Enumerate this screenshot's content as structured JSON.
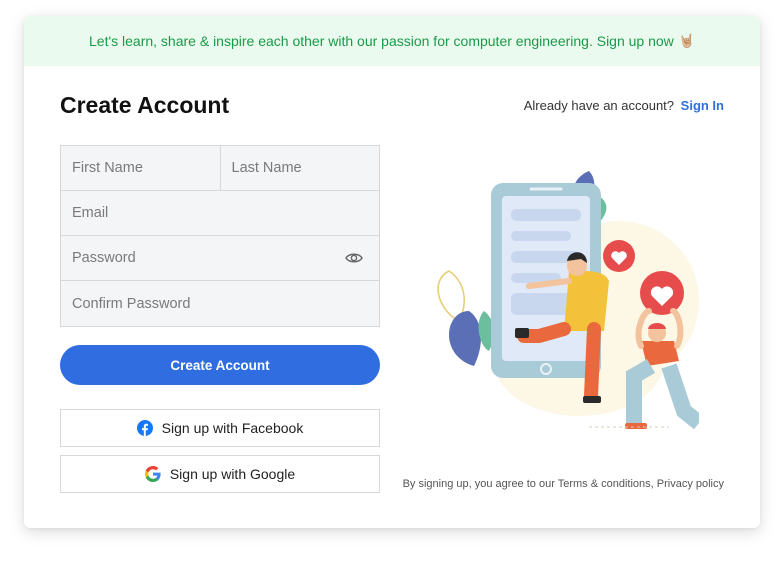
{
  "banner": {
    "text": "Let's learn, share & inspire each other with our passion for computer engineering. Sign up now",
    "emoji": "🤘🏼"
  },
  "header": {
    "title": "Create Account",
    "already_text": "Already have an account?",
    "signin_label": "Sign In"
  },
  "form": {
    "first_name_placeholder": "First Name",
    "last_name_placeholder": "Last Name",
    "email_placeholder": "Email",
    "password_placeholder": "Password",
    "confirm_password_placeholder": "Confirm Password",
    "password_visibility_icon": "eye-icon"
  },
  "buttons": {
    "create_account_label": "Create Account",
    "facebook_label": "Sign up with Facebook",
    "google_label": "Sign up with Google"
  },
  "footer": {
    "terms_text": "By signing up, you agree to our Terms & conditions, Privacy policy"
  },
  "colors": {
    "primary": "#2f6de1",
    "banner_bg": "#ebfaef",
    "banner_text": "#199a47",
    "link": "#2f6fe0"
  }
}
